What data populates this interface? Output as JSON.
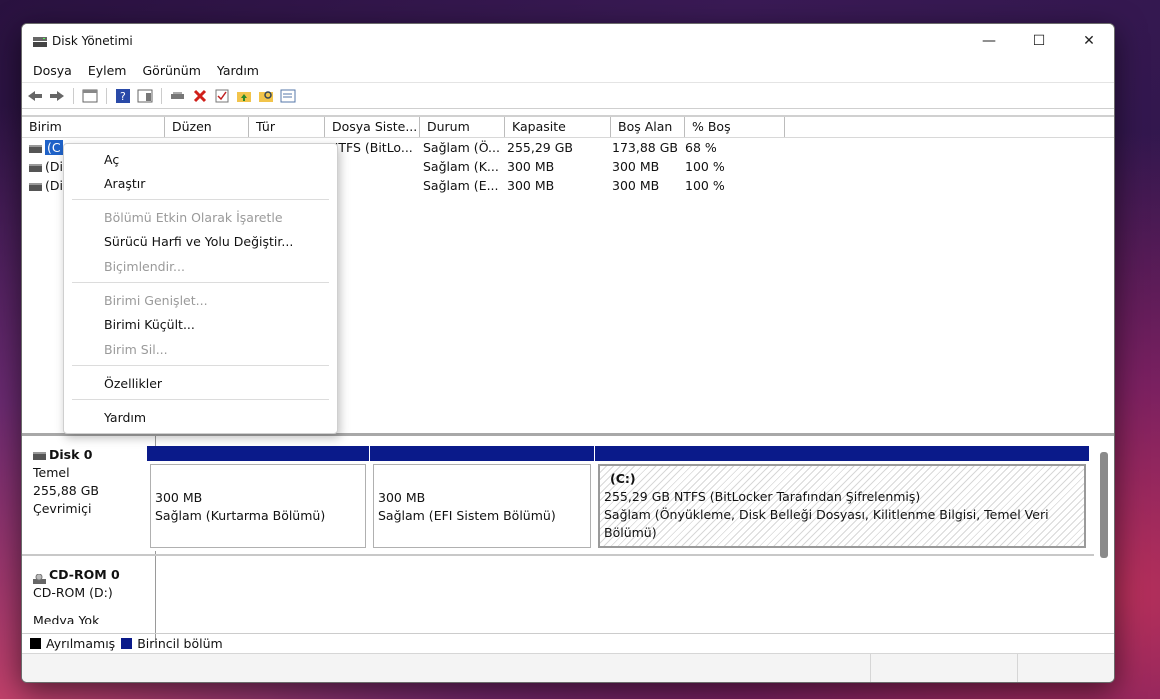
{
  "window": {
    "title": "Disk Yönetimi",
    "minimize": "—",
    "maximize": "☐",
    "close": "✕"
  },
  "menu": [
    "Dosya",
    "Eylem",
    "Görünüm",
    "Yardım"
  ],
  "table": {
    "columns": [
      "Birim",
      "Düzen",
      "Tür",
      "Dosya Siste...",
      "Durum",
      "Kapasite",
      "Boş Alan",
      "% Boş"
    ],
    "rows": [
      {
        "birim": "(C",
        "duzen": "",
        "tur": "",
        "dosya": "NTFS (BitLo...",
        "durum": "Sağlam (Ö...",
        "kapasite": "255,29 GB",
        "bos": "173,88 GB",
        "yuzde": "68 %"
      },
      {
        "birim": "(Di",
        "duzen": "",
        "tur": "",
        "dosya": "",
        "durum": "Sağlam (K...",
        "kapasite": "300 MB",
        "bos": "300 MB",
        "yuzde": "100 %"
      },
      {
        "birim": "(Di",
        "duzen": "",
        "tur": "",
        "dosya": "",
        "durum": "Sağlam (E...",
        "kapasite": "300 MB",
        "bos": "300 MB",
        "yuzde": "100 %"
      }
    ]
  },
  "context_menu": [
    {
      "label": "Aç",
      "enabled": true
    },
    {
      "label": "Araştır",
      "enabled": true
    },
    {
      "label": "Bölümü Etkin Olarak İşaretle",
      "enabled": false
    },
    {
      "label": "Sürücü Harfi ve Yolu Değiştir...",
      "enabled": true
    },
    {
      "label": "Biçimlendir...",
      "enabled": false
    },
    {
      "label": "Birimi Genişlet...",
      "enabled": false
    },
    {
      "label": "Birimi Küçült...",
      "enabled": true
    },
    {
      "label": "Birim Sil...",
      "enabled": false
    },
    {
      "label": "Özellikler",
      "enabled": true
    },
    {
      "label": "Yardım",
      "enabled": true
    }
  ],
  "disk0": {
    "name": "Disk 0",
    "type": "Temel",
    "size": "255,88 GB",
    "status": "Çevrimiçi",
    "partitions": [
      {
        "line1": "300 MB",
        "line2": "Sağlam (Kurtarma Bölümü)"
      },
      {
        "line1": "300 MB",
        "line2": "Sağlam (EFI Sistem Bölümü)"
      },
      {
        "name": "(C:)",
        "line1": "255,29 GB NTFS (BitLocker Tarafından Şifrelenmiş)",
        "line2": "Sağlam (Önyükleme, Disk Belleği Dosyası, Kilitlenme Bilgisi, Temel Veri Bölümü)"
      }
    ]
  },
  "cdrom0": {
    "name": "CD-ROM 0",
    "drive": "CD-ROM (D:)",
    "media": "Medya Yok"
  },
  "legend": [
    {
      "label": "Ayrılmamış",
      "color": "#000000"
    },
    {
      "label": "Birincil bölüm",
      "color": "#0a1a8a"
    }
  ]
}
